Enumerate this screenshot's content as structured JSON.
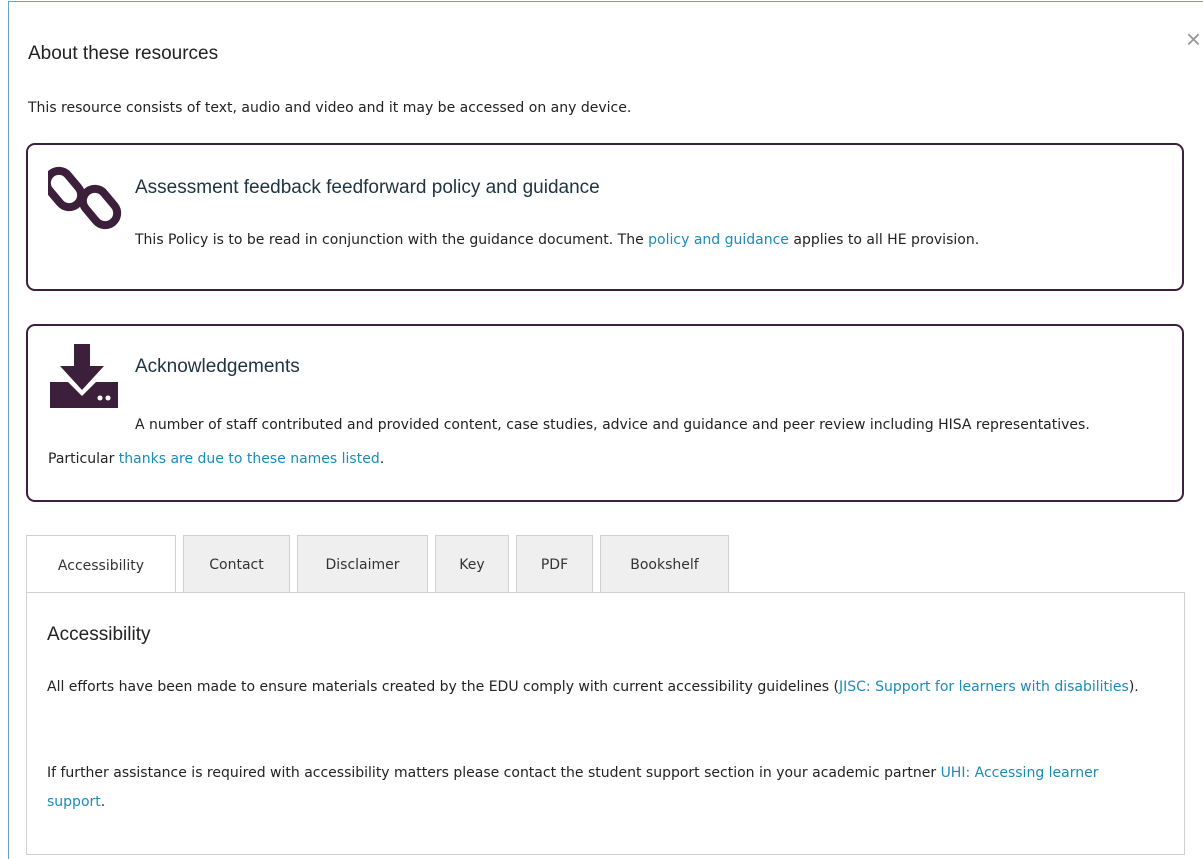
{
  "modal": {
    "title": "About these resources",
    "close_label": "×",
    "intro": "This resource consists of text, audio and video and it may be accessed on any device."
  },
  "cards": [
    {
      "icon": "link-icon",
      "title": "Assessment feedback feedforward policy and guidance",
      "text_before": "This Policy is to be read in conjunction with the guidance document. The ",
      "link": "policy and guidance",
      "text_after": " applies to all HE provision."
    },
    {
      "icon": "download-icon",
      "title": "Acknowledgements",
      "text_before": "A number of staff contributed and provided content, case studies, advice and guidance and peer review including HISA representatives. Particular ",
      "link": "thanks are due to these names listed",
      "text_after": "."
    }
  ],
  "tabs": [
    {
      "label": "Accessibility",
      "active": true
    },
    {
      "label": "Contact",
      "active": false
    },
    {
      "label": "Disclaimer",
      "active": false
    },
    {
      "label": "Key",
      "active": false
    },
    {
      "label": "PDF",
      "active": false
    },
    {
      "label": "Bookshelf",
      "active": false
    }
  ],
  "panel": {
    "title": "Accessibility",
    "p1_before": "All efforts have been made to ensure materials created by the EDU comply with current accessibility guidelines (",
    "p1_link": "JISC: Support for learners with disabilities",
    "p1_after": ").",
    "p2_before": "If further assistance is required with accessibility matters please contact the student support section in your academic partner ",
    "p2_link": "UHI: Accessing learner support",
    "p2_after": "."
  },
  "colors": {
    "card_border": "#3b1f3b",
    "icon": "#3b1f3b",
    "link": "#1a8cb8",
    "modal_border": "#6a9fd4"
  }
}
